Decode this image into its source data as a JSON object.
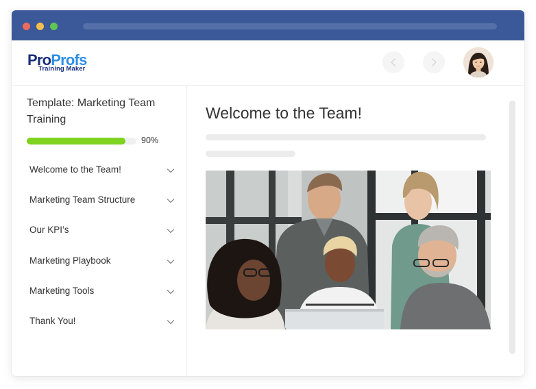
{
  "colors": {
    "titlebar": "#3b5998",
    "dot_red": "#ed6a5e",
    "dot_yellow": "#f5bf4f",
    "dot_green": "#61c554",
    "accent_progress": "#7ed321",
    "text": "#333333"
  },
  "logo": {
    "part1": "Pro",
    "part2": "Profs",
    "subtitle": "Training Maker"
  },
  "nav": {
    "prev_icon": "chevron-left-icon",
    "next_icon": "chevron-right-icon"
  },
  "sidebar": {
    "title": "Template: Marketing Team Training",
    "progress": {
      "percent": 90,
      "label": "90%"
    },
    "items": [
      {
        "label": "Welcome to the Team!"
      },
      {
        "label": "Marketing Team Structure"
      },
      {
        "label": "Our KPI’s"
      },
      {
        "label": "Marketing Playbook"
      },
      {
        "label": "Marketing Tools"
      },
      {
        "label": "Thank You!"
      }
    ]
  },
  "main": {
    "title": "Welcome to the Team!"
  }
}
